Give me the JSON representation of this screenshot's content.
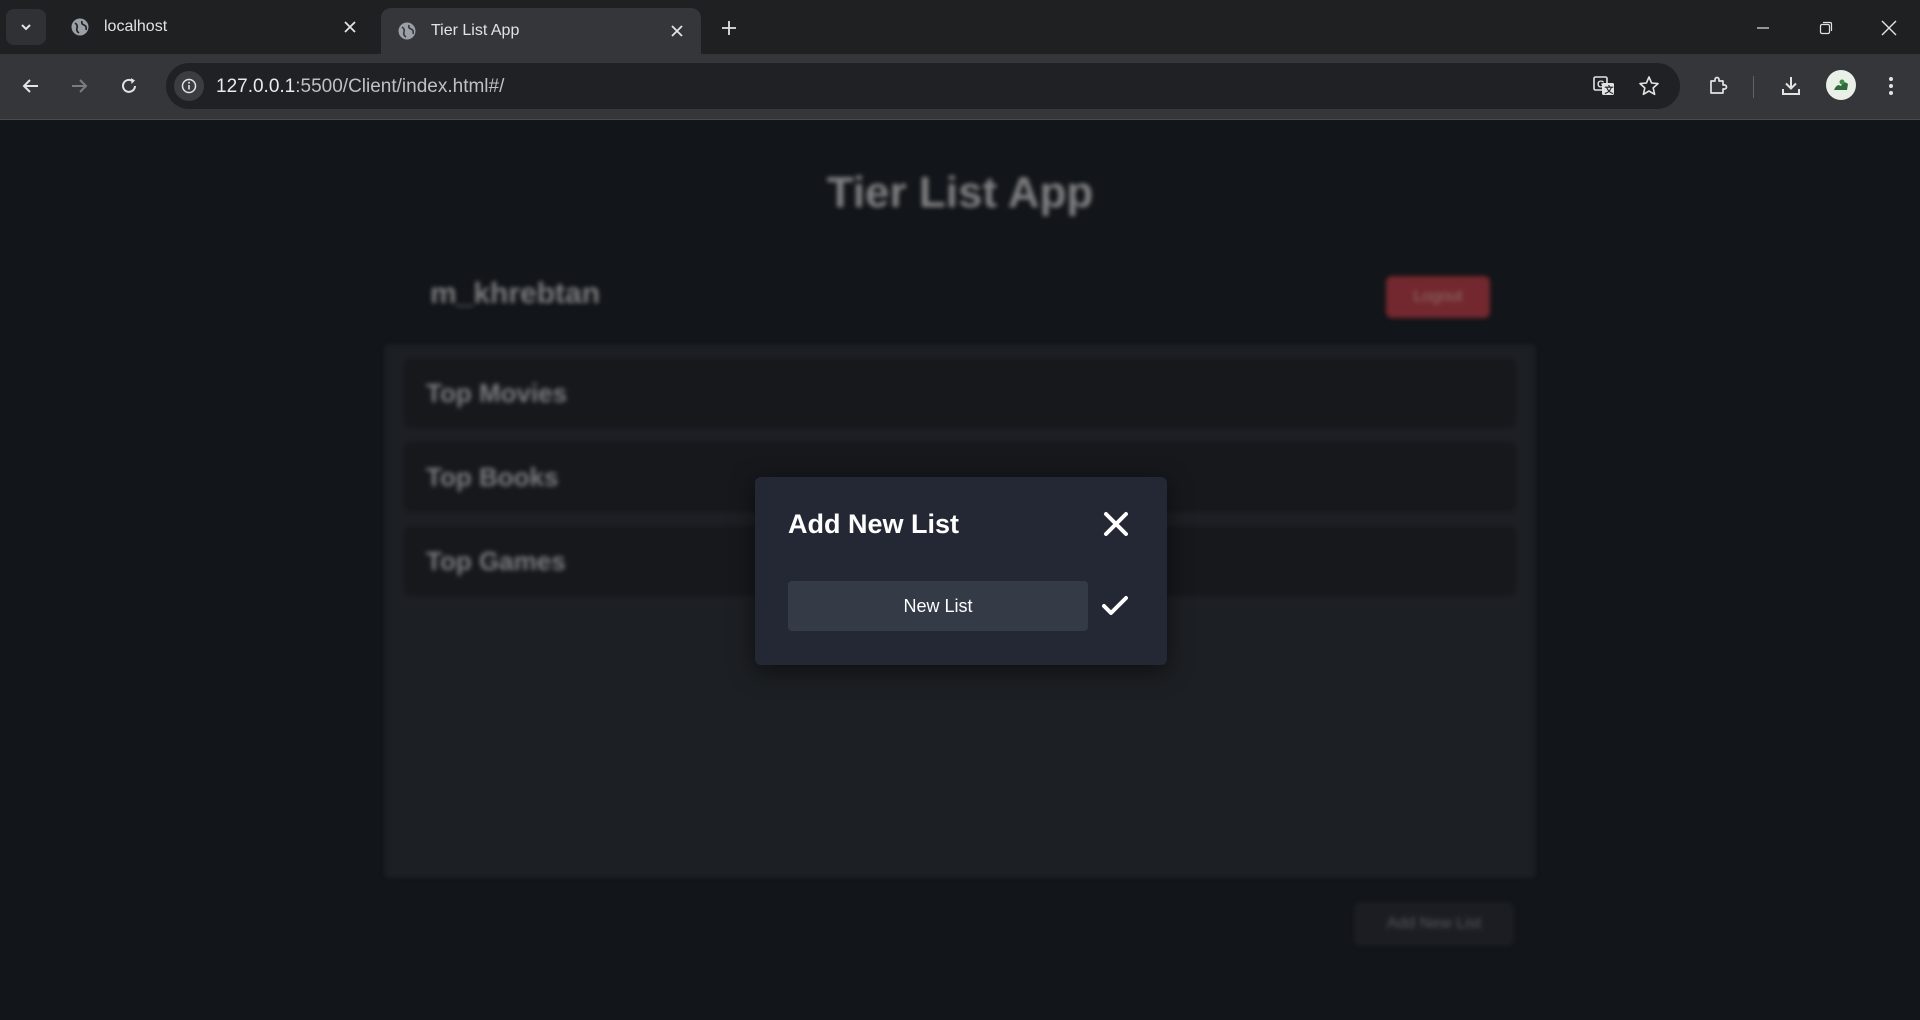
{
  "browser": {
    "tabs": [
      {
        "title": "localhost",
        "active": false
      },
      {
        "title": "Tier List App",
        "active": true
      }
    ],
    "url_host": "127.0.0.1",
    "url_rest": ":5500/Client/index.html#/"
  },
  "page": {
    "app_title": "Tier List App",
    "username": "m_khrebtan",
    "logout_label": "Logout",
    "lists": [
      "Top Movies",
      "Top Books",
      "Top Games"
    ],
    "add_new_list_label": "Add New List"
  },
  "modal": {
    "title": "Add New List",
    "input_placeholder": "New List",
    "input_value": ""
  },
  "colors": {
    "background": "#121519",
    "modal_bg": "#232834",
    "input_bg": "#353a47",
    "logout_red": "#c23a40"
  },
  "icons": [
    "tab-search-icon",
    "globe-icon",
    "close-icon",
    "plus-icon",
    "minimize-icon",
    "restore-icon",
    "back-arrow-icon",
    "forward-arrow-icon",
    "reload-icon",
    "site-info-icon",
    "translate-icon",
    "star-icon",
    "extensions-icon",
    "download-icon",
    "profile-avatar-icon",
    "more-vert-icon",
    "checkmark-icon"
  ]
}
